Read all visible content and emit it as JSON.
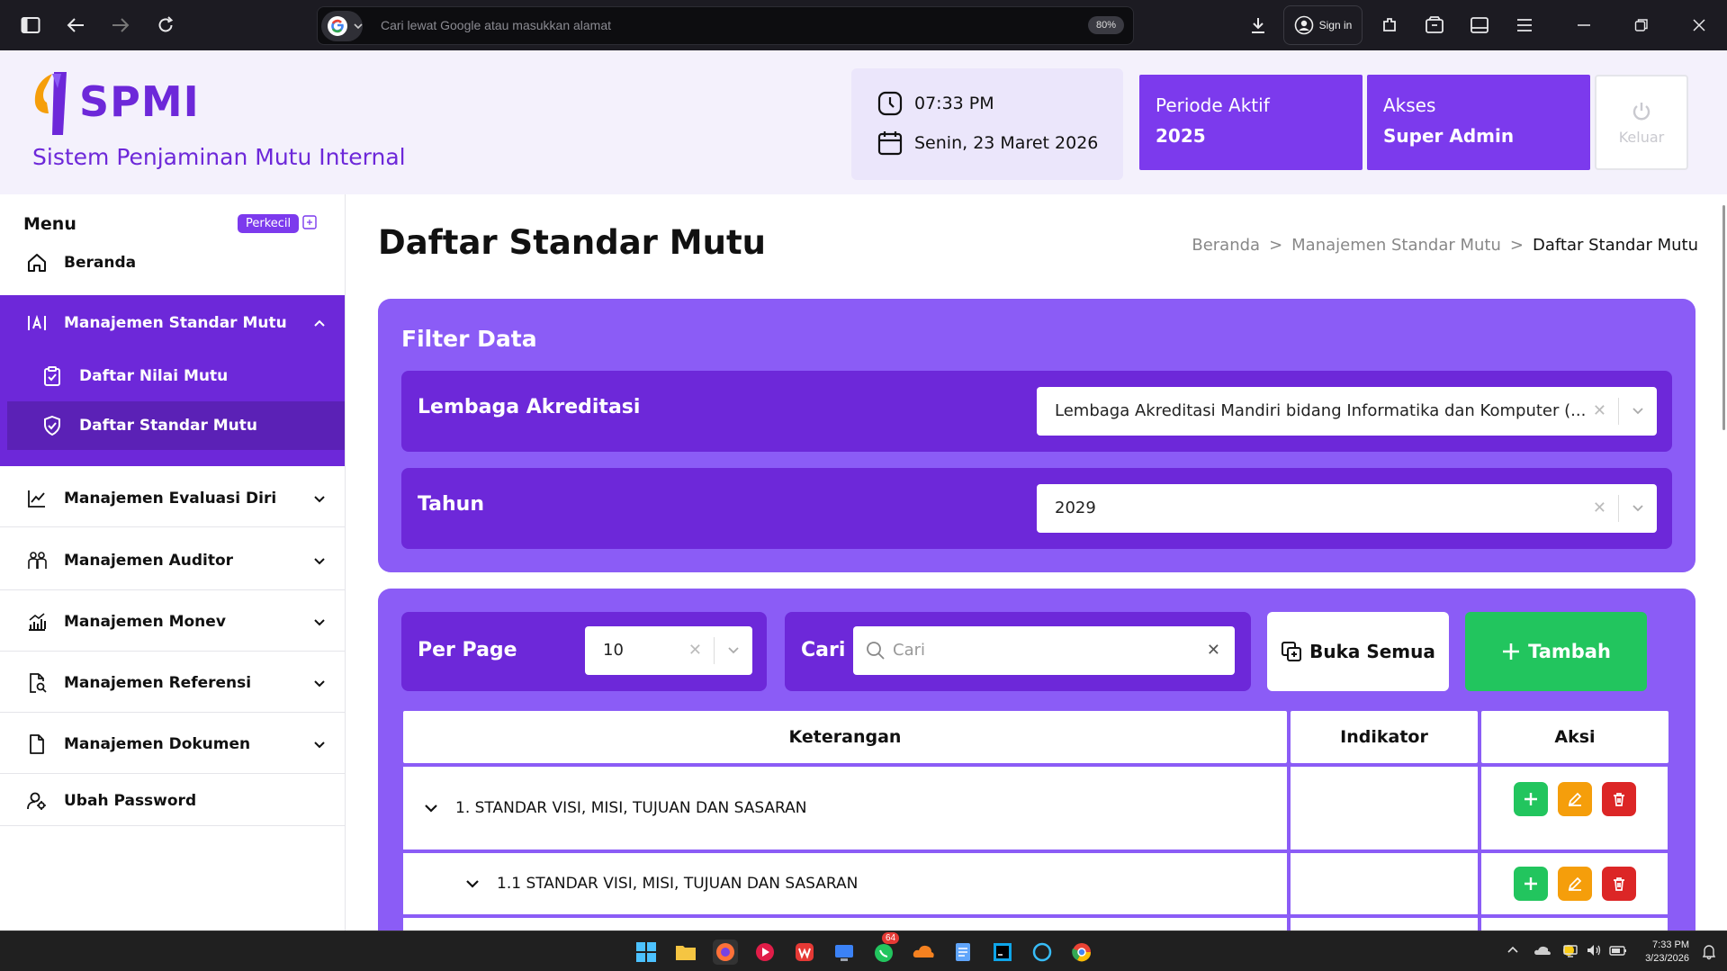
{
  "browser": {
    "url_placeholder": "Cari lewat Google atau masukkan alamat",
    "zoom": "80%",
    "signin_label": "Sign in"
  },
  "header": {
    "logo_text": "SPMI",
    "tagline": "Sistem Penjaminan Mutu Internal",
    "time": "07:33 PM",
    "date": "Senin, 23 Maret 2026",
    "period_label": "Periode Aktif",
    "period_value": "2025",
    "access_label": "Akses",
    "access_value": "Super Admin",
    "logout_label": "Keluar"
  },
  "sidebar": {
    "title": "Menu",
    "collapse_label": "Perkecil",
    "items": [
      {
        "label": "Beranda"
      },
      {
        "label": "Manajemen Standar Mutu"
      },
      {
        "label": "Daftar Nilai Mutu"
      },
      {
        "label": "Daftar Standar Mutu"
      },
      {
        "label": "Manajemen Evaluasi Diri"
      },
      {
        "label": "Manajemen Auditor"
      },
      {
        "label": "Manajemen Monev"
      },
      {
        "label": "Manajemen Referensi"
      },
      {
        "label": "Manajemen Dokumen"
      },
      {
        "label": "Ubah Password"
      }
    ]
  },
  "main": {
    "title": "Daftar Standar Mutu",
    "breadcrumb": [
      "Beranda",
      ">",
      "Manajemen Standar Mutu",
      ">",
      "Daftar Standar Mutu"
    ],
    "filter": {
      "title": "Filter Data",
      "lembaga_label": "Lembaga Akreditasi",
      "lembaga_value": "Lembaga Akreditasi Mandiri bidang Informatika dan Komputer (...",
      "tahun_label": "Tahun",
      "tahun_value": "2029"
    },
    "toolbar": {
      "perpage_label": "Per Page",
      "perpage_value": "10",
      "search_label": "Cari",
      "search_placeholder": "Cari",
      "open_all_label": "Buka Semua",
      "add_label": "Tambah"
    },
    "table": {
      "headers": [
        "Keterangan",
        "Indikator",
        "Aksi"
      ],
      "rows": [
        {
          "text": "1. STANDAR VISI, MISI, TUJUAN DAN SASARAN",
          "indikator": ""
        },
        {
          "text": "1.1 STANDAR VISI, MISI, TUJUAN DAN SASARAN",
          "indikator": ""
        }
      ]
    }
  },
  "taskbar": {
    "time": "7:33 PM",
    "date": "3/23/2026",
    "badge": "64"
  },
  "colors": {
    "primary": "#7c3aed",
    "primary_dark": "#6d28d9",
    "primary_light": "#8b5cf6",
    "success": "#22c55e",
    "warning": "#f59e0b",
    "danger": "#dc2626"
  }
}
